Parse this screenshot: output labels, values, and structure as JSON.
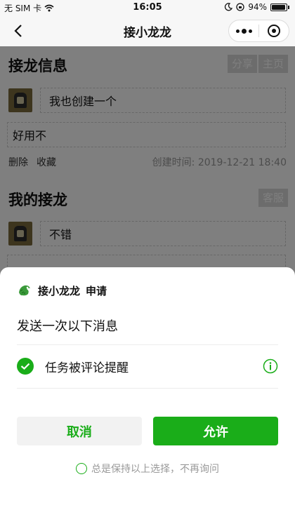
{
  "status_bar": {
    "carrier": "无 SIM 卡",
    "time": "16:05",
    "battery": "94%"
  },
  "navbar": {
    "title": "接小龙龙"
  },
  "page": {
    "section1": {
      "title": "接龙信息",
      "buttons": [
        "分享",
        "主页"
      ],
      "creator_message": "我也创建一个",
      "reply_message": "好用不",
      "actions": [
        "删除",
        "收藏"
      ],
      "created_label": "创建时间: 2019-12-21 18:40"
    },
    "section2": {
      "title": "我的接龙",
      "button": "客服",
      "message": "不错"
    }
  },
  "sheet": {
    "app_name": "接小龙龙",
    "request_label": "申请",
    "subtitle": "发送一次以下消息",
    "permission": "任务被评论提醒",
    "cancel_label": "取消",
    "allow_label": "允许",
    "remember_label": "总是保持以上选择，不再询问"
  },
  "colors": {
    "accent": "#1aad19",
    "overlay": "rgba(0,0,0,0.5)"
  }
}
